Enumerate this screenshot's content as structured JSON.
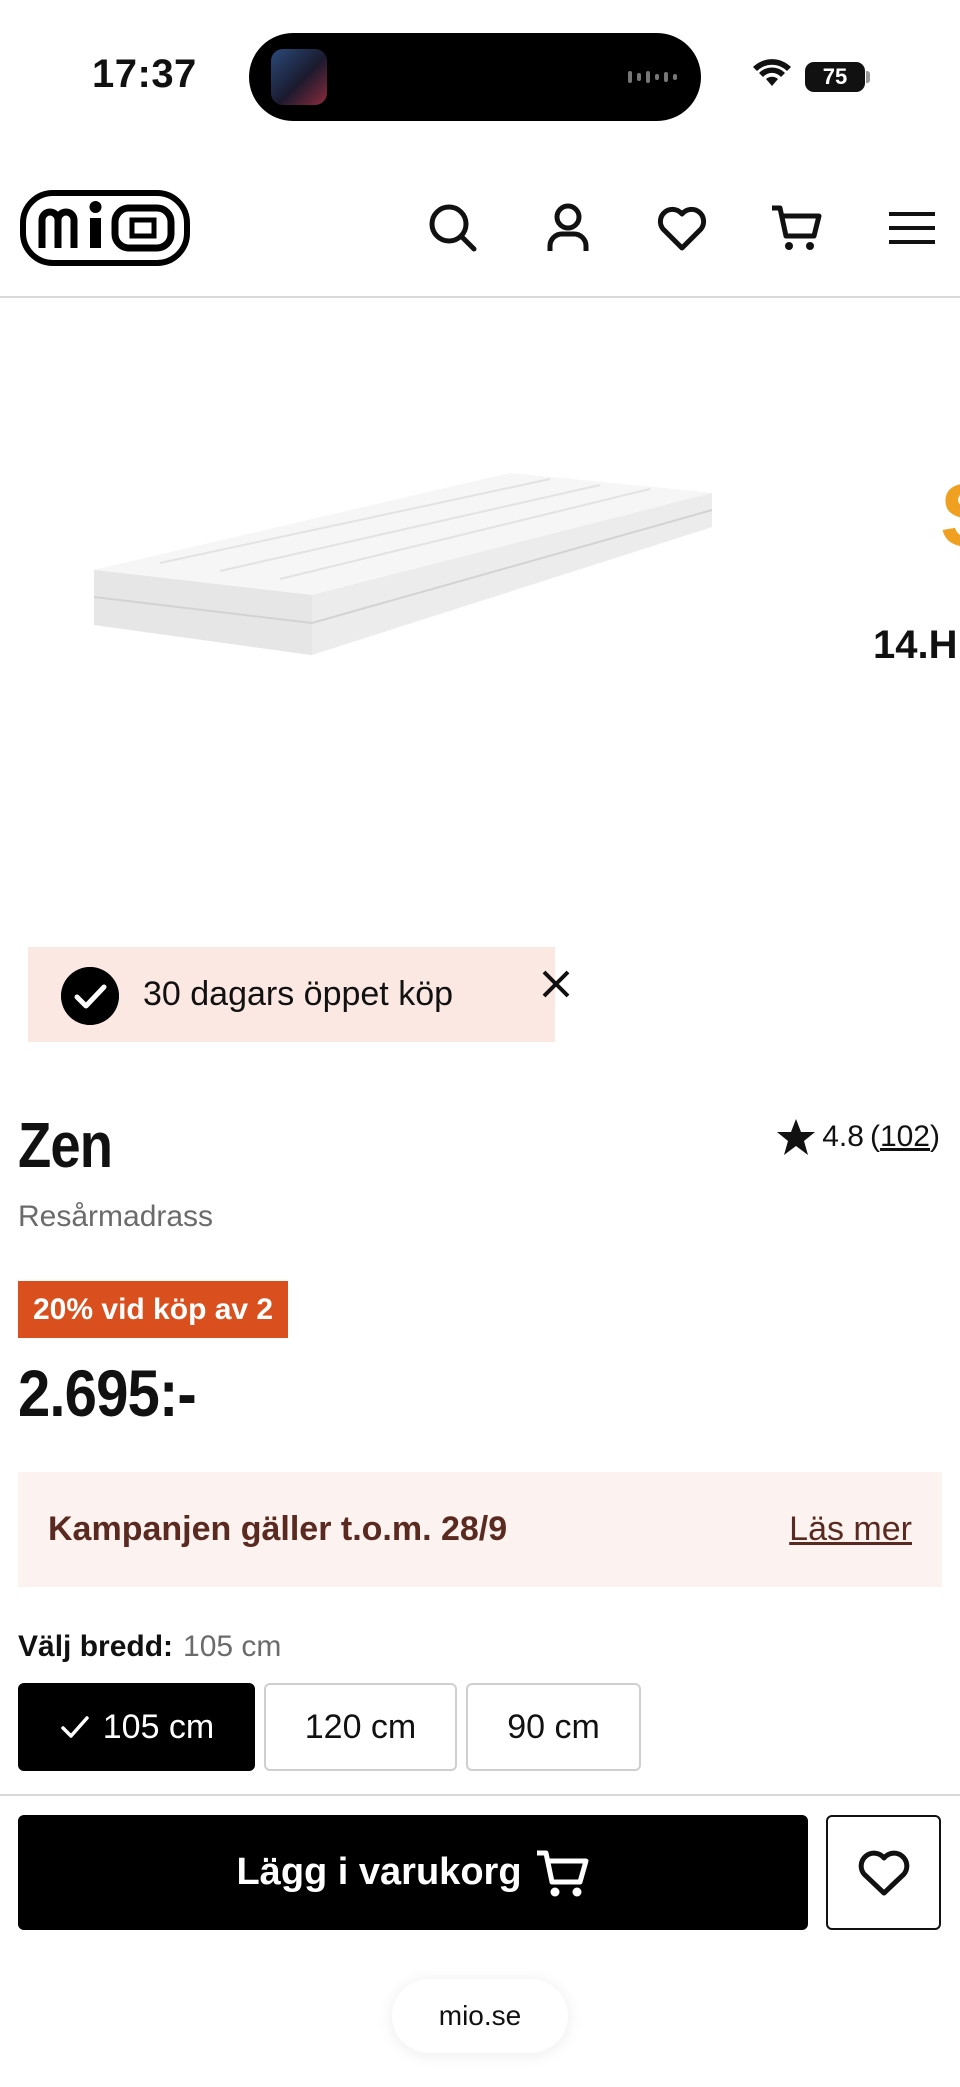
{
  "status_bar": {
    "time": "17:37",
    "battery": "75"
  },
  "header": {
    "logo_text": "mio",
    "icons": [
      "search-icon",
      "account-icon",
      "heart-icon",
      "cart-icon",
      "menu-icon"
    ]
  },
  "gallery": {
    "peek_letter": "S",
    "peek_text": "14.H"
  },
  "banner": {
    "text": "30 dagars öppet köp"
  },
  "product": {
    "name": "Zen",
    "subtitle": "Resårmadrass",
    "rating": "4.8",
    "review_open": "(",
    "review_count": "102",
    "review_close": ")",
    "promo_badge": "20% vid köp av 2",
    "price": "2.695:-"
  },
  "campaign": {
    "text": "Kampanjen gäller t.o.m. 28/9",
    "link": "Läs mer"
  },
  "width_selector": {
    "label": "Välj bredd:",
    "selected": "105 cm",
    "options": [
      "105 cm",
      "120 cm",
      "90 cm"
    ]
  },
  "actions": {
    "add_to_cart": "Lägg i varukorg"
  },
  "browser": {
    "url": "mio.se"
  },
  "colors": {
    "promo_badge": "#d9501e",
    "campaign_bg": "#fcf3f1",
    "banner_bg": "#fbe8e3",
    "primary": "#000000"
  }
}
